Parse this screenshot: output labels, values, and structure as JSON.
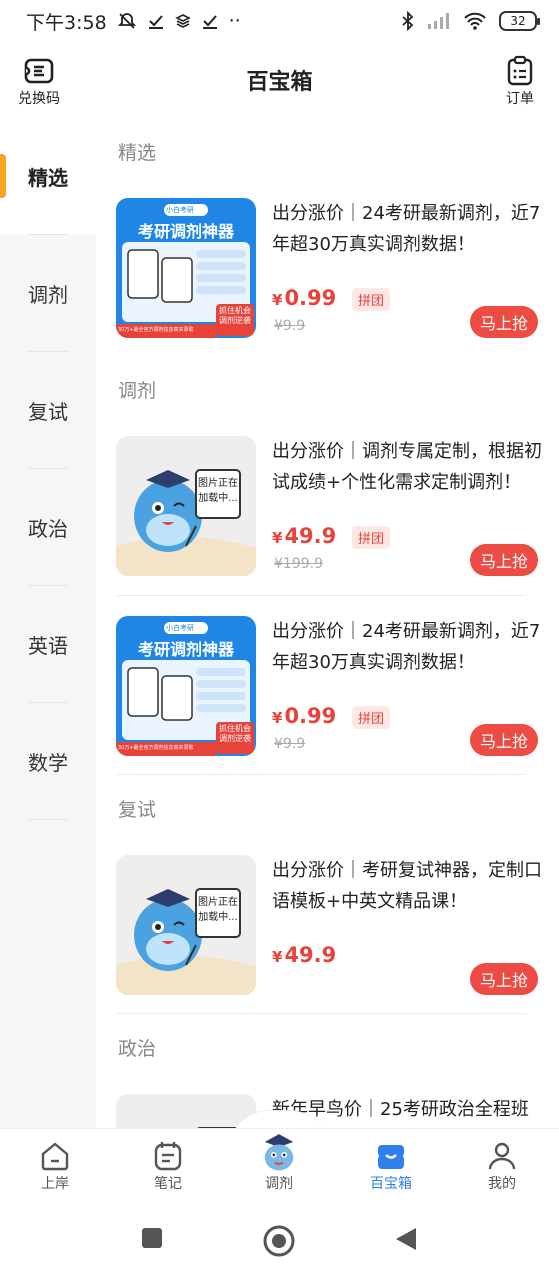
{
  "status_bar": {
    "time": "下午3:58",
    "notif_icons": [
      "mute-bell-icon",
      "check-icon",
      "layers-icon",
      "check-icon",
      "more-dots-icon"
    ],
    "more": "··",
    "battery": "32"
  },
  "header": {
    "title": "百宝箱",
    "left_label": "兑换码",
    "right_label": "订单"
  },
  "sidebar": {
    "items": [
      {
        "label": "精选",
        "active": true
      },
      {
        "label": "调剂",
        "active": false
      },
      {
        "label": "复试",
        "active": false
      },
      {
        "label": "政治",
        "active": false
      },
      {
        "label": "英语",
        "active": false
      },
      {
        "label": "数学",
        "active": false
      }
    ]
  },
  "sections": [
    {
      "title": "精选"
    },
    {
      "title": "调剂"
    },
    {
      "title": "复试"
    },
    {
      "title": "政治"
    }
  ],
  "products": [
    {
      "title": "出分涨价｜24考研最新调剂，近7年超30万真实调剂数据！",
      "currency": "¥",
      "price": "0.99",
      "tag": "拼团",
      "old_price": "¥9.9",
      "buy": "马上抢",
      "thumb": {
        "type": "poster",
        "brand": "小白考研",
        "headline": "考研调剂神器",
        "badge": "抓住机会 调剂逆袭",
        "footer": "30万+最全官方调剂信息真实录取"
      }
    },
    {
      "title": "出分涨价｜调剂专属定制，根据初试成绩+个性化需求定制调剂！",
      "currency": "¥",
      "price": "49.9",
      "tag": "拼团",
      "old_price": "¥199.9",
      "buy": "马上抢",
      "thumb": {
        "type": "mascot",
        "board": "图片正在 加载中..."
      }
    },
    {
      "title": "出分涨价｜24考研最新调剂，近7年超30万真实调剂数据！",
      "currency": "¥",
      "price": "0.99",
      "tag": "拼团",
      "old_price": "¥9.9",
      "buy": "马上抢",
      "thumb": {
        "type": "poster",
        "brand": "小白考研",
        "headline": "考研调剂神器",
        "badge": "抓住机会 调剂逆袭",
        "footer": "30万+最全官方调剂信息真实录取"
      }
    },
    {
      "title": "出分涨价｜考研复试神器，定制口语模板+中英文精品课！",
      "currency": "¥",
      "price": "49.9",
      "buy": "马上抢",
      "thumb": {
        "type": "mascot",
        "board": "图片正在 加载中..."
      }
    },
    {
      "title": "新年早鸟价｜25考研政治全程班",
      "thumb": {
        "type": "mascot"
      }
    }
  ],
  "bottom_nav": [
    {
      "label": "上岸",
      "icon": "home-icon",
      "active": false
    },
    {
      "label": "笔记",
      "icon": "notebook-icon",
      "active": false
    },
    {
      "label": "调剂",
      "icon": "mascot-icon",
      "active": false
    },
    {
      "label": "百宝箱",
      "icon": "treasure-box-icon",
      "active": true
    },
    {
      "label": "我的",
      "icon": "person-icon",
      "active": false
    }
  ],
  "colors": {
    "accent": "#f5a623",
    "price": "#e8433a",
    "buy_button": "#ec4c44",
    "nav_active": "#2f80ed",
    "poster_blue": "#1f86e6"
  }
}
